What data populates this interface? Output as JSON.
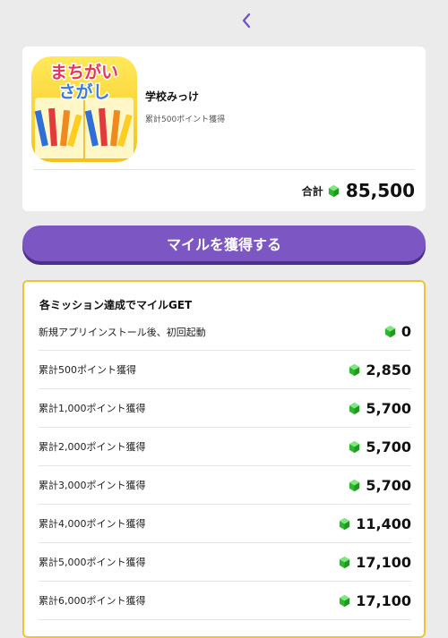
{
  "header": {
    "back_icon": "chevron-left-icon"
  },
  "app": {
    "name": "学校みっけ",
    "subtitle": "累計500ポイント獲得",
    "icon_title": "まちがいさがし",
    "total_label": "合計",
    "total_value": "85,500"
  },
  "cta": {
    "label": "マイルを獲得する"
  },
  "missions": {
    "title": "各ミッション達成でマイルGET",
    "items": [
      {
        "label": "新規アプリインストール後、初回起動",
        "value": "0"
      },
      {
        "label": "累計500ポイント獲得",
        "value": "2,850"
      },
      {
        "label": "累計1,000ポイント獲得",
        "value": "5,700"
      },
      {
        "label": "累計2,000ポイント獲得",
        "value": "5,700"
      },
      {
        "label": "累計3,000ポイント獲得",
        "value": "5,700"
      },
      {
        "label": "累計4,000ポイント獲得",
        "value": "11,400"
      },
      {
        "label": "累計5,000ポイント獲得",
        "value": "17,100"
      },
      {
        "label": "累計6,000ポイント獲得",
        "value": "17,100"
      }
    ]
  },
  "colors": {
    "accent": "#7c57c3",
    "mission_border": "#f2c230",
    "gem": "#3ccf3c"
  }
}
